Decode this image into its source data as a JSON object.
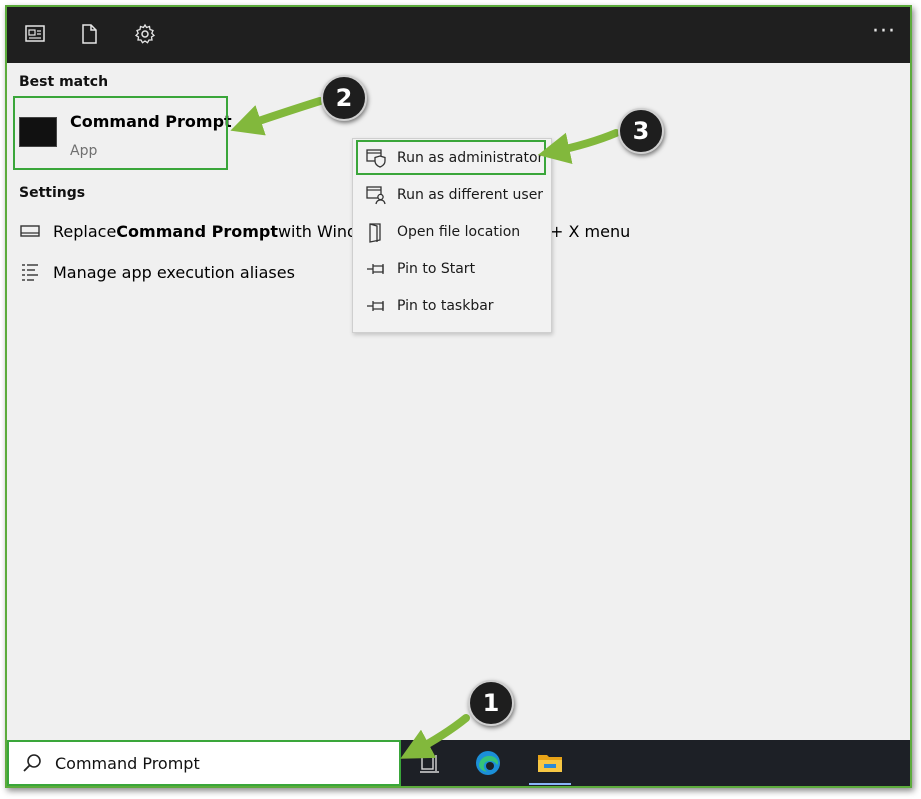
{
  "top_icons": [
    "news-icon",
    "document-icon",
    "gear-icon"
  ],
  "more_label": "···",
  "best_match": {
    "heading": "Best match",
    "app_name": "Command Prompt",
    "app_type": "App"
  },
  "settings": {
    "heading": "Settings",
    "items": [
      {
        "prefix": "Replace ",
        "bold": "Command Prompt",
        "suffix": " with Windo",
        "tail": "+ X menu"
      },
      {
        "text": "Manage app execution aliases"
      }
    ]
  },
  "context_menu": {
    "items": [
      {
        "label": "Run as administrator",
        "icon": "shield-window-icon"
      },
      {
        "label": "Run as different user",
        "icon": "user-window-icon"
      },
      {
        "label": "Open file location",
        "icon": "folder-location-icon"
      },
      {
        "label": "Pin to Start",
        "icon": "pin-icon"
      },
      {
        "label": "Pin to taskbar",
        "icon": "pin-icon"
      }
    ]
  },
  "taskbar": {
    "search_value": "Command Prompt"
  },
  "callouts": [
    "1",
    "2",
    "3"
  ],
  "colors": {
    "highlight": "#3aa63a",
    "arrow": "#82b83c",
    "topbar": "#1f1f1f",
    "taskbar": "#1d2026",
    "panel": "#f0f0f0"
  }
}
